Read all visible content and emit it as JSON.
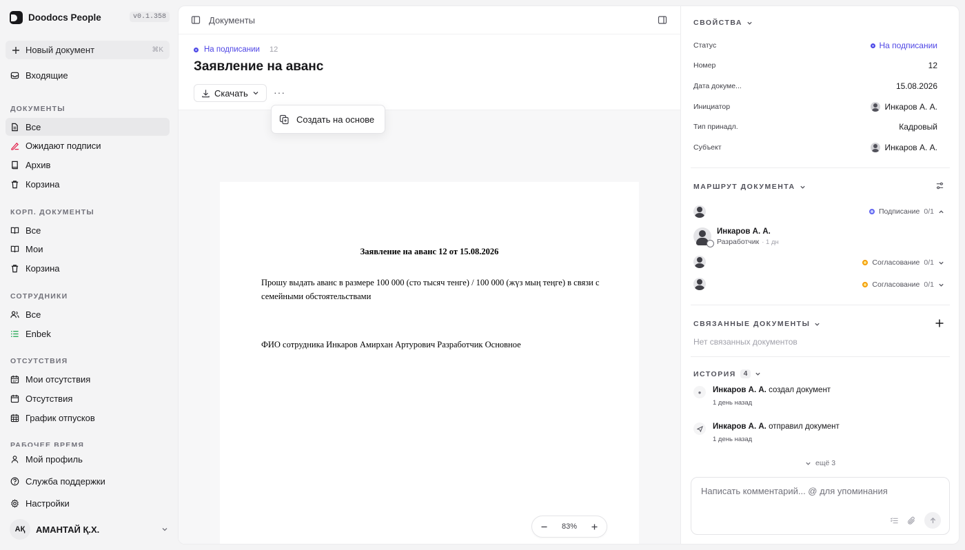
{
  "app": {
    "name": "Doodocs People",
    "version": "v0.1.358"
  },
  "sidebar": {
    "new_doc": {
      "label": "Новый документ",
      "shortcut": "⌘K"
    },
    "inbox": "Входящие",
    "sections": {
      "docs": "ДОКУМЕНТЫ",
      "corp": "КОРП. ДОКУМЕНТЫ",
      "staff": "СОТРУДНИКИ",
      "absence": "ОТСУТСТВИЯ",
      "worktime": "РАБОЧЕЕ ВРЕМЯ"
    },
    "docs": {
      "all": "Все",
      "pending": "Ожидают подписи",
      "archive": "Архив",
      "trash": "Корзина"
    },
    "corp": {
      "all": "Все",
      "mine": "Мои",
      "trash": "Корзина"
    },
    "staff": {
      "all": "Все",
      "enbek": "Enbek"
    },
    "absence": {
      "mine": "Мои отсутствия",
      "all": "Отсутствия",
      "vacation": "График отпусков"
    },
    "bottom": {
      "profile": "Мой профиль",
      "support": "Служба поддержки",
      "settings": "Настройки"
    },
    "user": {
      "initials": "АҚ",
      "name": "АМАНТАЙ Қ.Х."
    }
  },
  "topbar": {
    "breadcrumb": "Документы"
  },
  "document": {
    "status": "На подписании",
    "number": "12",
    "title": "Заявление на аванс",
    "download_label": "Скачать",
    "more_label": "···",
    "menu_item": "Создать на основе",
    "paper": {
      "title": "Заявление на аванс 12 от 15.08.2026",
      "body": "Прошу выдать аванс в размере 100 000 (сто тысяч тенге) / 100 000 (жүз мың теңге) в связи с семейными обстоятельствами",
      "signature": "ФИО сотрудника Инкаров Амирхан Артурович Разработчик Основное"
    },
    "zoom": "83%"
  },
  "properties": {
    "title": "СВОЙСТВА",
    "rows": [
      {
        "label": "Статус",
        "value": "На подписании"
      },
      {
        "label": "Номер",
        "value": "12"
      },
      {
        "label": "Дата докуме...",
        "value": "15.08.2026"
      },
      {
        "label": "Инициатор",
        "value": "Инкаров А. А."
      },
      {
        "label": "Тип принадл.",
        "value": "Кадровый"
      },
      {
        "label": "Субъект",
        "value": "Инкаров А. А."
      }
    ]
  },
  "route": {
    "title": "МАРШРУТ ДОКУМЕНТА",
    "steps": [
      {
        "label": "Подписание",
        "count": "0/1"
      },
      {
        "label": "Согласование",
        "count": "0/1"
      },
      {
        "label": "Согласование",
        "count": "0/1"
      }
    ],
    "signer": {
      "name": "Инкаров А. А.",
      "role": "Разработчик",
      "time": "· 1 дн"
    }
  },
  "linked": {
    "title": "СВЯЗАННЫЕ ДОКУМЕНТЫ",
    "empty": "Нет связанных документов"
  },
  "history": {
    "title": "ИСТОРИЯ",
    "count": "4",
    "items": [
      {
        "actor": "Инкаров А. А.",
        "action": "создал документ",
        "time": "1 день назад"
      },
      {
        "actor": "Инкаров А. А.",
        "action": "отправил документ",
        "time": "1 день назад"
      }
    ],
    "more": "ещё 3"
  },
  "comment": {
    "placeholder": "Написать комментарий... @ для упоминания"
  },
  "colors": {
    "accent": "#4f46e5",
    "warning": "#f59e0b",
    "signature_red": "#e11d48"
  }
}
